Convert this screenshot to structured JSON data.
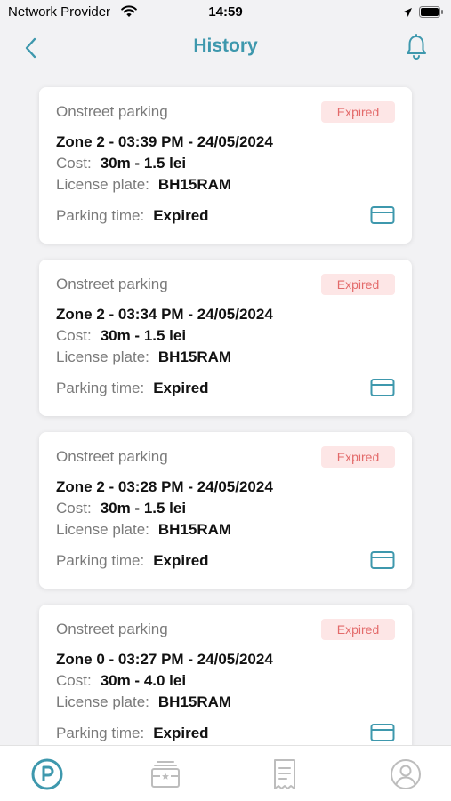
{
  "status_bar": {
    "carrier": "Network Provider",
    "time": "14:59"
  },
  "header": {
    "title": "History",
    "back_icon": "chevron-left-icon",
    "bell_icon": "bell-icon"
  },
  "labels": {
    "cost": "Cost:",
    "license_plate": "License plate:",
    "parking_time": "Parking time:"
  },
  "colors": {
    "accent": "#3e98ad",
    "badge_bg": "#fde6e6",
    "badge_text": "#e36a6a",
    "background": "#f2f2f4"
  },
  "records": [
    {
      "type": "Onstreet parking",
      "status": "Expired",
      "zone_line": "Zone 2 - 03:39 PM - 24/05/2024",
      "cost": "30m  - 1.5 lei",
      "plate": "BH15RAM",
      "parking_time": "Expired"
    },
    {
      "type": "Onstreet parking",
      "status": "Expired",
      "zone_line": "Zone 2 - 03:34 PM - 24/05/2024",
      "cost": "30m  - 1.5 lei",
      "plate": "BH15RAM",
      "parking_time": "Expired"
    },
    {
      "type": "Onstreet parking",
      "status": "Expired",
      "zone_line": "Zone 2 - 03:28 PM - 24/05/2024",
      "cost": "30m  - 1.5 lei",
      "plate": "BH15RAM",
      "parking_time": "Expired"
    },
    {
      "type": "Onstreet parking",
      "status": "Expired",
      "zone_line": "Zone 0 - 03:27 PM - 24/05/2024",
      "cost": "30m  - 4.0 lei",
      "plate": "BH15RAM",
      "parking_time": "Expired"
    }
  ],
  "tabbar": {
    "items": [
      {
        "icon": "parking-icon",
        "active": true
      },
      {
        "icon": "ticket-icon",
        "active": false
      },
      {
        "icon": "receipt-icon",
        "active": false
      },
      {
        "icon": "profile-icon",
        "active": false
      }
    ]
  }
}
